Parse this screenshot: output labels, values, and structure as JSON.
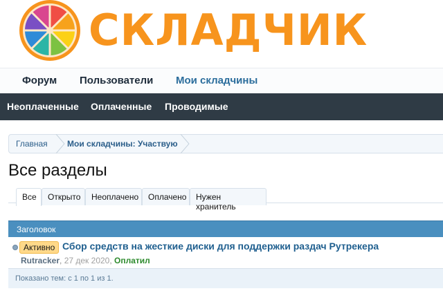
{
  "brand": {
    "logo_text": "СКЛАДЧИК",
    "logo_icon": "citrus-slice-icon",
    "colors": {
      "logo_orange": "#f7941d",
      "nav_dark": "#2f3b45",
      "link_blue": "#2b6d9c",
      "table_header": "#4a8fbf"
    }
  },
  "main_nav": {
    "items": [
      {
        "label": "Форум"
      },
      {
        "label": "Пользователи"
      },
      {
        "label": "Мои складчины",
        "active": true
      }
    ]
  },
  "sub_nav": {
    "items": [
      {
        "label": "Неоплаченные"
      },
      {
        "label": "Оплаченные"
      },
      {
        "label": "Проводимые"
      }
    ]
  },
  "breadcrumb": {
    "items": [
      {
        "label": "Главная"
      },
      {
        "label": "Мои складчины: Участвую"
      }
    ]
  },
  "page": {
    "title": "Все разделы"
  },
  "tabs": [
    {
      "label": "Все",
      "active": true
    },
    {
      "label": "Открыто"
    },
    {
      "label": "Неоплачено"
    },
    {
      "label": "Оплачено"
    },
    {
      "label": "Нужен хранитель"
    }
  ],
  "table": {
    "header": "Заголовок",
    "rows": [
      {
        "prefix": "Активно",
        "title": "Сбор средств на жесткие диски для поддержки раздач Рутрекера",
        "author": "Rutracker",
        "date": "27 дек 2020",
        "status": "Оплатил"
      }
    ],
    "footer": "Показано тем: с 1 по 1 из 1."
  }
}
